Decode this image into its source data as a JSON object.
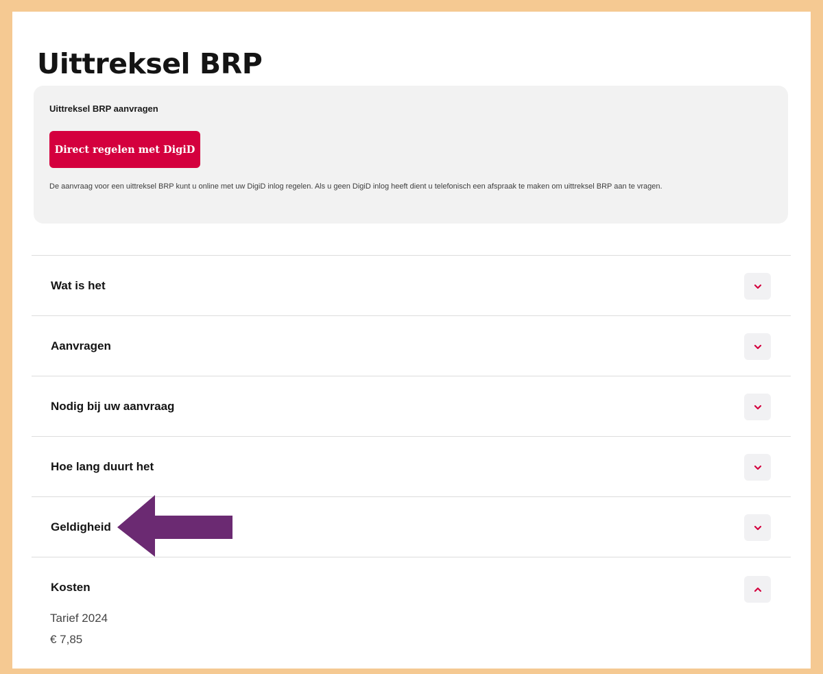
{
  "page": {
    "title": "Uittreksel BRP"
  },
  "cta": {
    "heading": "Uittreksel BRP aanvragen",
    "button_label": "Direct regelen met DigiD",
    "description": "De aanvraag voor een uittreksel BRP kunt u online met uw DigiD inlog regelen. Als u geen DigiD inlog heeft dient u telefonisch een afspraak te maken om uittreksel BRP aan te vragen."
  },
  "accordion": {
    "items": [
      {
        "label": "Wat is het",
        "expanded": false,
        "icon": "chevron-down-icon"
      },
      {
        "label": "Aanvragen",
        "expanded": false,
        "icon": "chevron-down-icon"
      },
      {
        "label": "Nodig bij uw aanvraag",
        "expanded": false,
        "icon": "chevron-down-icon"
      },
      {
        "label": "Hoe lang duurt het",
        "expanded": false,
        "icon": "chevron-down-icon"
      },
      {
        "label": "Geldigheid",
        "expanded": false,
        "icon": "chevron-down-icon"
      },
      {
        "label": "Kosten",
        "expanded": true,
        "icon": "chevron-up-icon"
      }
    ],
    "kosten_content": {
      "tariff_label": "Tarief 2024",
      "price": "€ 7,85"
    }
  },
  "annotation": {
    "icon": "left-arrow-icon"
  },
  "colors": {
    "brand": "#d4003e",
    "page_border": "#f5c992",
    "card_background": "#f2f2f2",
    "annotation_arrow": "#6b2a72"
  }
}
